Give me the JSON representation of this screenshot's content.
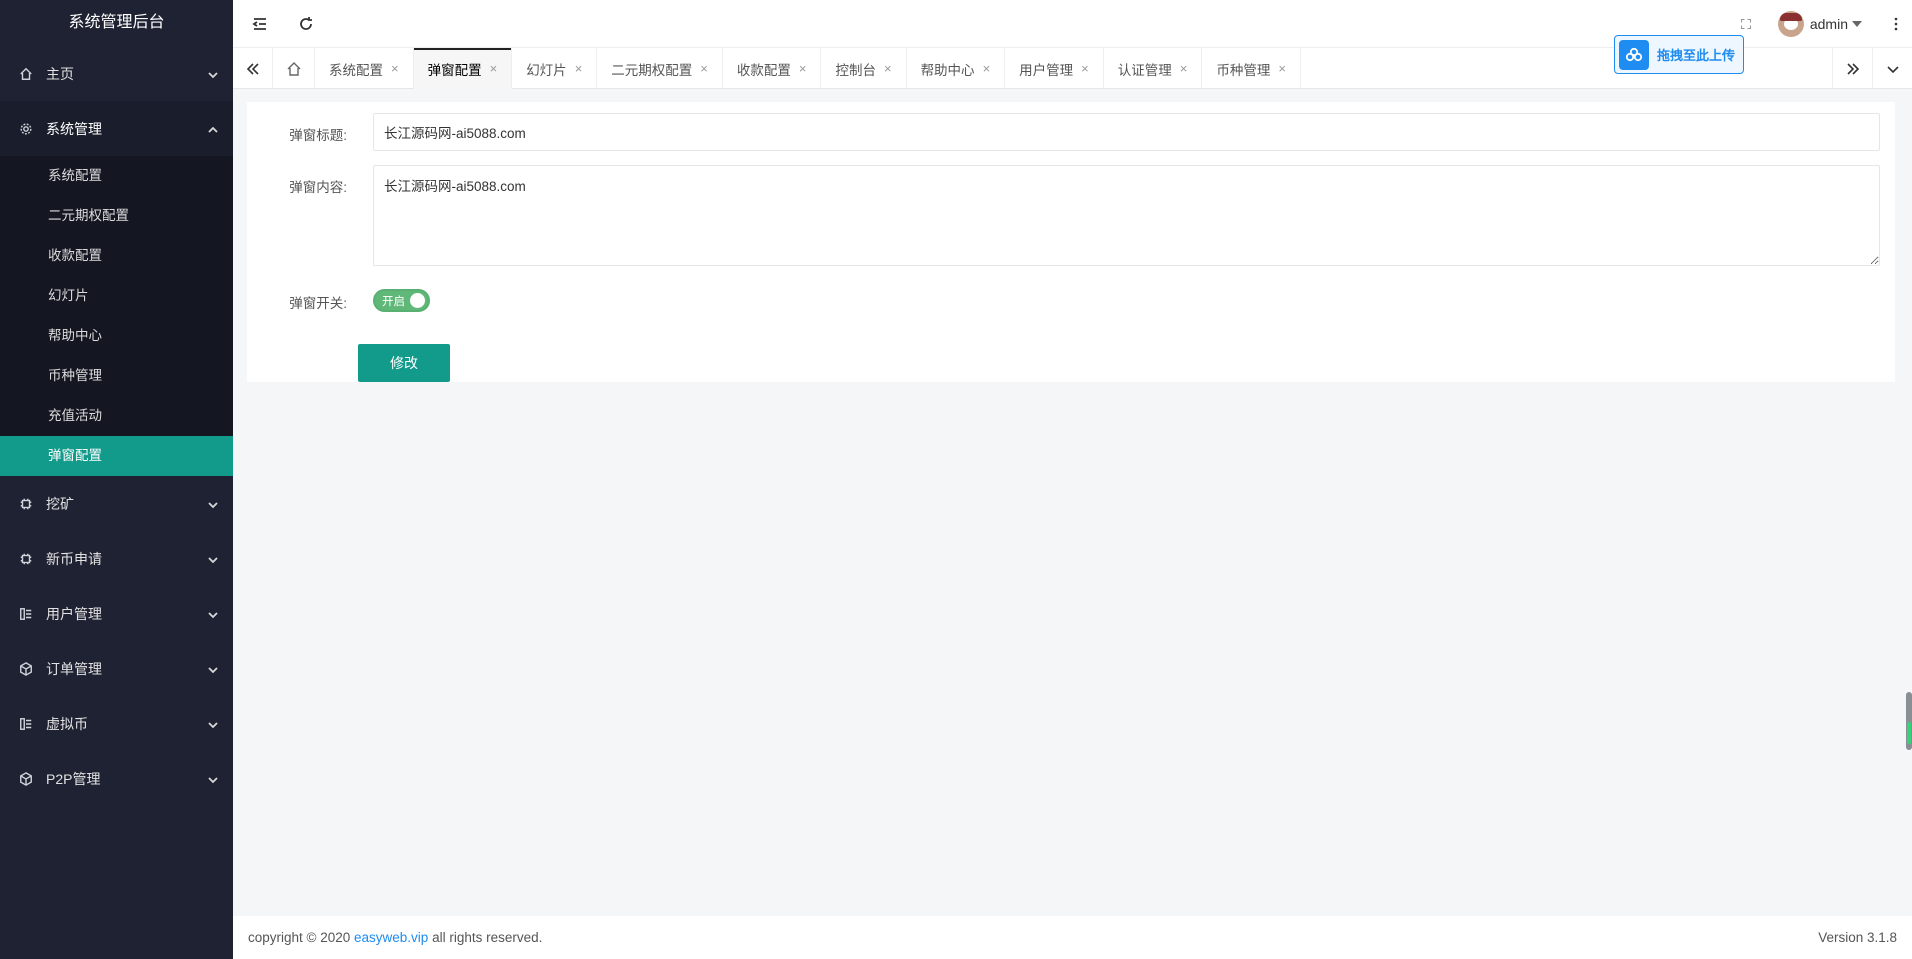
{
  "app": {
    "title": "系统管理后台"
  },
  "sidebar": {
    "items": [
      {
        "label": "主页",
        "icon": "home-icon",
        "expanded": false
      },
      {
        "label": "系统管理",
        "icon": "gear-icon",
        "expanded": true,
        "children": [
          "系统配置",
          "二元期权配置",
          "收款配置",
          "幻灯片",
          "帮助中心",
          "币种管理",
          "充值活动",
          "弹窗配置"
        ],
        "active_child": "弹窗配置"
      },
      {
        "label": "挖矿",
        "icon": "chip-icon",
        "expanded": false
      },
      {
        "label": "新币申请",
        "icon": "chip-icon",
        "expanded": false
      },
      {
        "label": "用户管理",
        "icon": "list-icon",
        "expanded": false
      },
      {
        "label": "订单管理",
        "icon": "box-icon",
        "expanded": false
      },
      {
        "label": "虚拟币",
        "icon": "list-icon",
        "expanded": false
      },
      {
        "label": "P2P管理",
        "icon": "box-icon",
        "expanded": false
      }
    ]
  },
  "header": {
    "user_name": "admin"
  },
  "tabs": {
    "items": [
      {
        "label": "系统配置",
        "active": false
      },
      {
        "label": "弹窗配置",
        "active": true
      },
      {
        "label": "幻灯片",
        "active": false
      },
      {
        "label": "二元期权配置",
        "active": false
      },
      {
        "label": "收款配置",
        "active": false
      },
      {
        "label": "控制台",
        "active": false
      },
      {
        "label": "帮助中心",
        "active": false
      },
      {
        "label": "用户管理",
        "active": false
      },
      {
        "label": "认证管理",
        "active": false
      },
      {
        "label": "币种管理",
        "active": false
      }
    ],
    "close_glyph": "×"
  },
  "upload": {
    "label": "拖拽至此上传"
  },
  "form": {
    "title_label": "弹窗标题:",
    "title_value": "长江源码网-ai5088.com",
    "content_label": "弹窗内容:",
    "content_value": "长江源码网-ai5088.com",
    "switch_label": "弹窗开关:",
    "switch_text": "开启",
    "switch_on": true,
    "submit_label": "修改"
  },
  "footer": {
    "copyright_prefix": "copyright © 2020 ",
    "link_text": "easyweb.vip",
    "copyright_suffix": " all rights reserved.",
    "version": "Version 3.1.8"
  },
  "colors": {
    "accent": "#129a8a",
    "sidebar_bg": "#1f2233",
    "switch_on": "#5fb878",
    "link": "#1e8cf0"
  }
}
